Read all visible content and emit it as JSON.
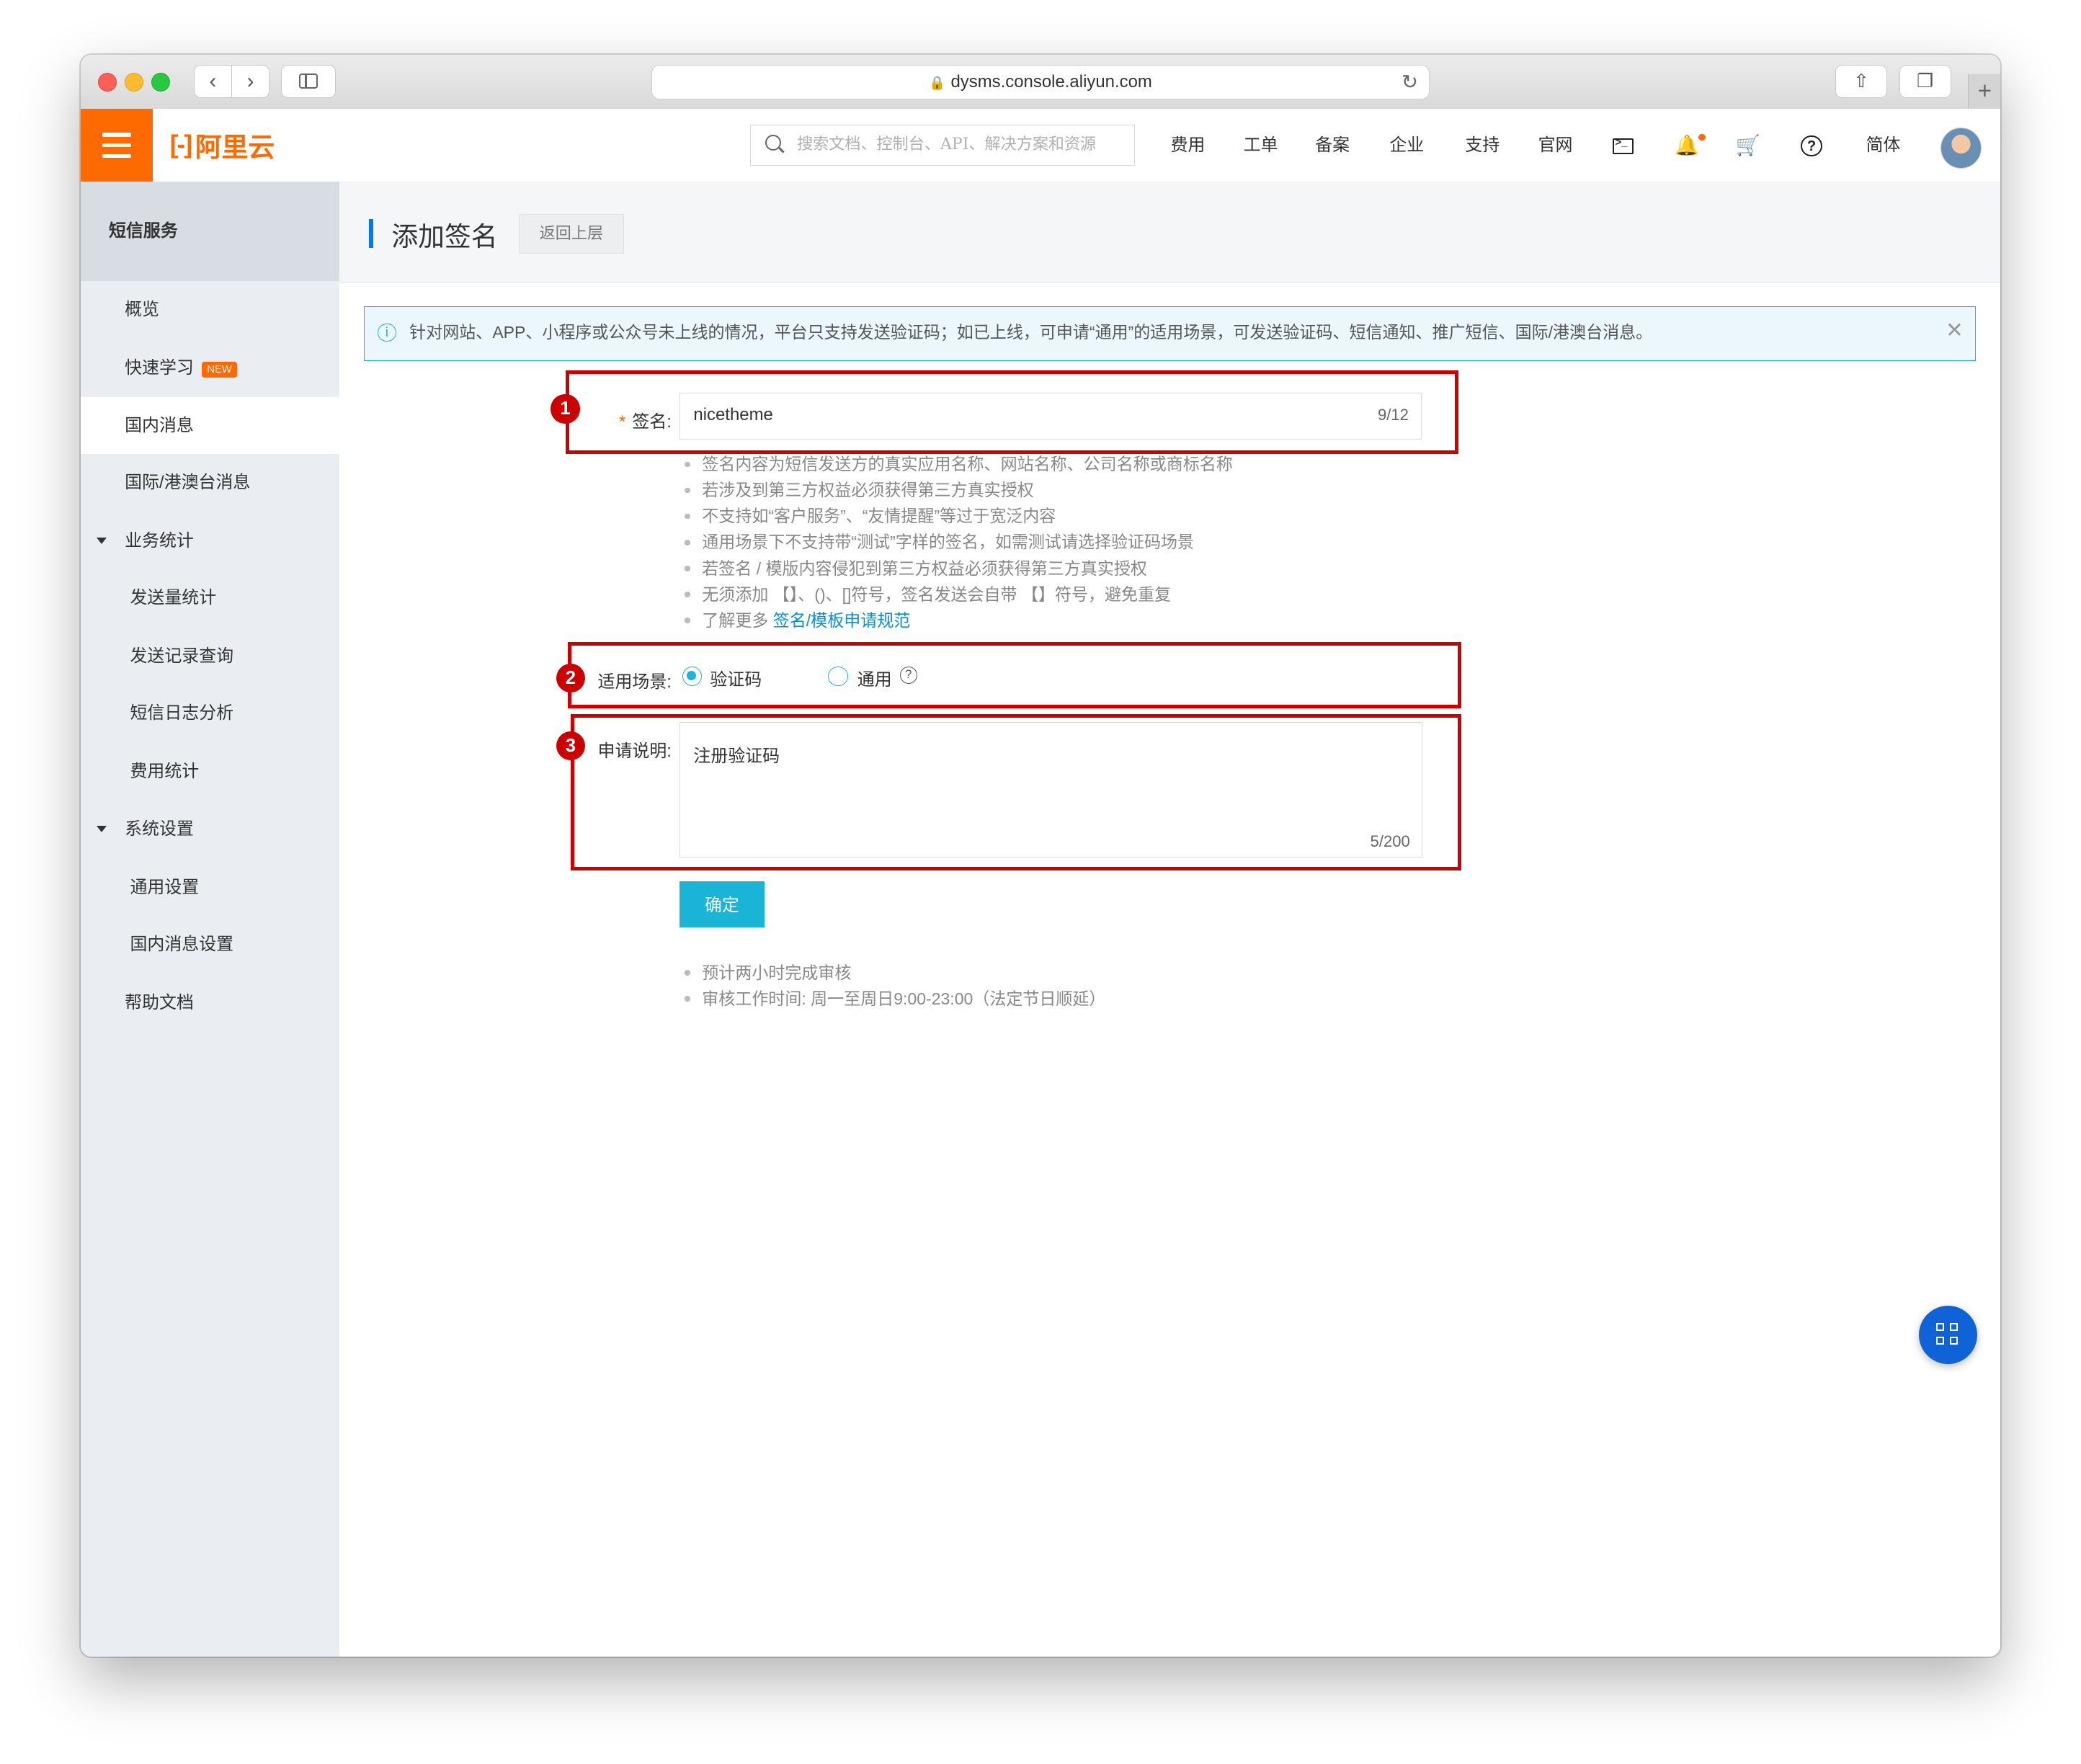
{
  "browser": {
    "url": "dysms.console.aliyun.com",
    "back_glyph": "‹",
    "forward_glyph": "›",
    "lock_glyph": "🔒",
    "reload_glyph": "↻",
    "share_glyph": "⇧",
    "tabs_glyph": "❐",
    "newtab_glyph": "+"
  },
  "header": {
    "logo_mark": "[-]",
    "logo_text": "阿里云",
    "search_placeholder": "搜索文档、控制台、API、解决方案和资源",
    "nav": [
      "费用",
      "工单",
      "备案",
      "企业",
      "支持",
      "官网"
    ],
    "lang": "简体",
    "cart_glyph": "🛒",
    "bell_glyph": "🔔",
    "help_glyph": "?",
    "accent": "#ff6a00"
  },
  "sidebar": {
    "title": "短信服务",
    "items": [
      {
        "label": "概览"
      },
      {
        "label": "快速学习",
        "badge": "NEW"
      },
      {
        "label": "国内消息",
        "active": true
      },
      {
        "label": "国际/港澳台消息"
      },
      {
        "label": "业务统计",
        "group": true
      },
      {
        "label": "发送量统计"
      },
      {
        "label": "发送记录查询"
      },
      {
        "label": "短信日志分析"
      },
      {
        "label": "费用统计"
      },
      {
        "label": "系统设置",
        "group": true
      },
      {
        "label": "通用设置"
      },
      {
        "label": "国内消息设置"
      },
      {
        "label": "帮助文档"
      }
    ]
  },
  "page": {
    "title": "添加签名",
    "back_label": "返回上层",
    "notice": "针对网站、APP、小程序或公众号未上线的情况，平台只支持发送验证码；如已上线，可申请“通用”的适用场景，可发送验证码、短信通知、推广短信、国际/港澳台消息。",
    "notice_close": "✕",
    "info_glyph": "i"
  },
  "form": {
    "signature": {
      "required_mark": "*",
      "label": "签名:",
      "value": "nicetheme",
      "counter": "9/12"
    },
    "hints": [
      "签名内容为短信发送方的真实应用名称、网站名称、公司名称或商标名称",
      "若涉及到第三方权益必须获得第三方真实授权",
      "不支持如“客户服务”、“友情提醒”等过于宽泛内容",
      "通用场景下不支持带“测试”字样的签名，如需测试请选择验证码场景",
      "若签名 / 模版内容侵犯到第三方权益必须获得第三方真实授权",
      "无须添加 【】、()、[]符号，签名发送会自带 【】符号，避免重复"
    ],
    "hint_more_prefix": "了解更多 ",
    "hint_more_link": "签名/模板申请规范",
    "scene": {
      "label": "适用场景:",
      "options": [
        "验证码",
        "通用"
      ],
      "selected": "验证码",
      "help_glyph": "?"
    },
    "description": {
      "label": "申请说明:",
      "value": "注册验证码",
      "counter": "5/200"
    },
    "submit_label": "确定",
    "footer_notes": [
      "预计两小时完成审核",
      "审核工作时间: 周一至周日9:00-23:00（法定节日顺延）"
    ]
  },
  "annotations": [
    "1",
    "2",
    "3"
  ],
  "colors": {
    "annotation": "#cc0000",
    "primary_button": "#19b4d6",
    "fab": "#0f63d6"
  }
}
